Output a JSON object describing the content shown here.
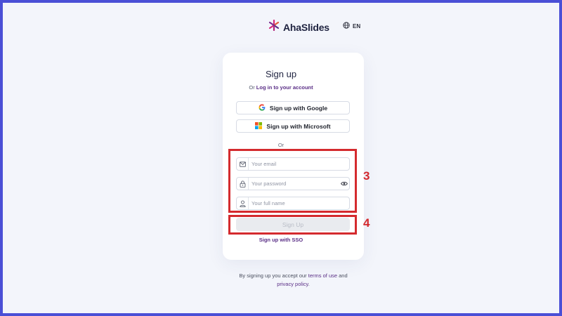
{
  "header": {
    "logo_text": "AhaSlides",
    "language": "EN",
    "icons": {
      "logo": "ahaslides-logo-icon",
      "language": "globe-icon"
    }
  },
  "form": {
    "title": "Sign up",
    "subtitle_prefix": "Or",
    "login_link": "Log in to your account",
    "google_button": "Sign up with Google",
    "microsoft_button": "Sign up with Microsoft",
    "divider": "Or",
    "email_placeholder": "Your email",
    "password_placeholder": "Your password",
    "fullname_placeholder": "Your full name",
    "submit_label": "Sign Up",
    "sso_link": "Sign up with SSO"
  },
  "terms": {
    "line1_prefix": "By signing up you accept our",
    "terms_link": "terms of use",
    "and_word": "and",
    "privacy_link": "privacy policy",
    "suffix": "."
  },
  "annotations": {
    "fields_number": "3",
    "button_number": "4",
    "highlight_color": "#d42a2e"
  },
  "colors": {
    "frame": "#4a4fd6",
    "background": "#f3f5fb",
    "link": "#5a2e86",
    "disabled_button": "#e9ebef"
  }
}
